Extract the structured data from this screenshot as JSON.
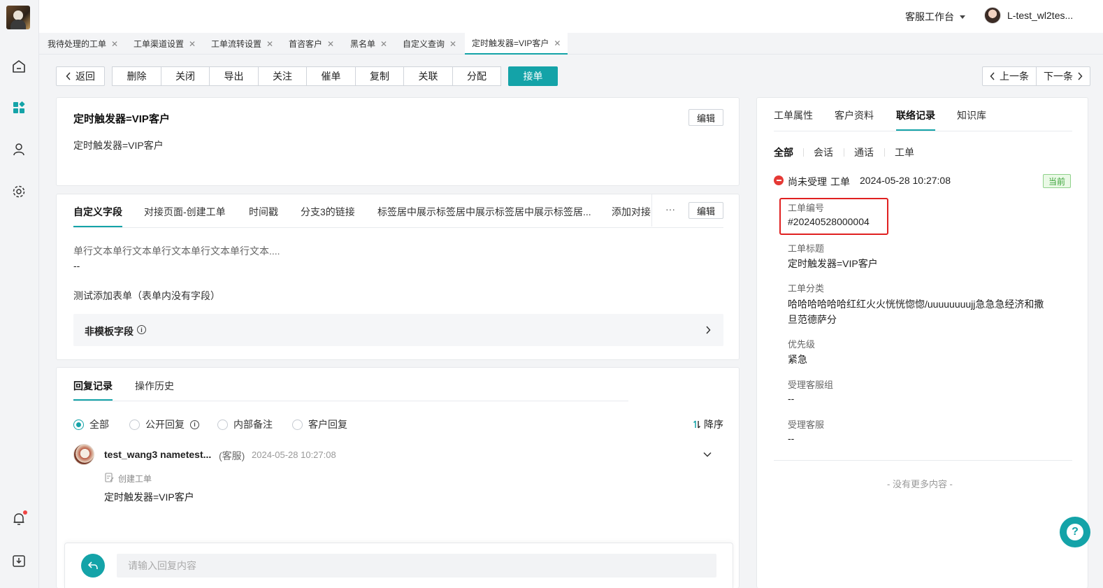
{
  "topbar": {
    "workspace": "客服工作台",
    "user_name": "L-test_wl2tes..."
  },
  "tabs": [
    {
      "label": "我待处理的工单"
    },
    {
      "label": "工单渠道设置"
    },
    {
      "label": "工单流转设置"
    },
    {
      "label": "首咨客户"
    },
    {
      "label": "黑名单"
    },
    {
      "label": "自定义查询"
    },
    {
      "label": "定时触发器=VIP客户"
    }
  ],
  "toolbar": {
    "back": "返回",
    "actions": [
      "删除",
      "关闭",
      "导出",
      "关注",
      "催单",
      "复制",
      "关联",
      "分配"
    ],
    "accept": "接单",
    "prev": "上一条",
    "next": "下一条"
  },
  "ticket": {
    "title": "定时触发器=VIP客户",
    "description": "定时触发器=VIP客户",
    "edit": "编辑"
  },
  "fields": {
    "tabs": [
      "自定义字段",
      "对接页面-创建工单",
      "时间戳",
      "分支3的链接",
      "标签居中展示标签居中展示标签居中展示标签居...",
      "添加对接"
    ],
    "more": "···",
    "edit": "编辑",
    "single_text_label": "单行文本单行文本单行文本单行文本单行文本....",
    "single_text_value": "--",
    "test_form": "测试添加表单（表单内没有字段）",
    "non_template": "非模板字段"
  },
  "reply": {
    "tabs": [
      "回复记录",
      "操作历史"
    ],
    "filters": [
      "全部",
      "公开回复",
      "内部备注",
      "客户回复"
    ],
    "sort": "降序",
    "entry": {
      "name": "test_wang3 nametest...",
      "role": "(客服)",
      "time": "2024-05-28 10:27:08",
      "action": "创建工单",
      "content": "定时触发器=VIP客户"
    },
    "input_placeholder": "请输入回复内容"
  },
  "right": {
    "tabs": [
      "工单属性",
      "客户资料",
      "联络记录",
      "知识库"
    ],
    "subtabs": [
      "全部",
      "会话",
      "通话",
      "工单"
    ],
    "record": {
      "status": "尚未受理",
      "type": "工单",
      "time": "2024-05-28 10:27:08",
      "badge": "当前",
      "items": [
        {
          "label": "工单编号",
          "value": "#20240528000004"
        },
        {
          "label": "工单标题",
          "value": "定时触发器=VIP客户"
        },
        {
          "label": "工单分类",
          "value": "哈哈哈哈哈哈红红火火恍恍惚惚/uuuuuuuujj急急急经济和撒旦范德萨分"
        },
        {
          "label": "优先级",
          "value": "紧急"
        },
        {
          "label": "受理客服组",
          "value": "--"
        },
        {
          "label": "受理客服",
          "value": "--"
        }
      ]
    },
    "no_more": "- 没有更多内容 -"
  },
  "colors": {
    "accent": "#14a3a8",
    "highlight": "#e02020",
    "badge_bg": "#eaf9e6",
    "badge_text": "#3aa33a",
    "status": "#e53935"
  }
}
